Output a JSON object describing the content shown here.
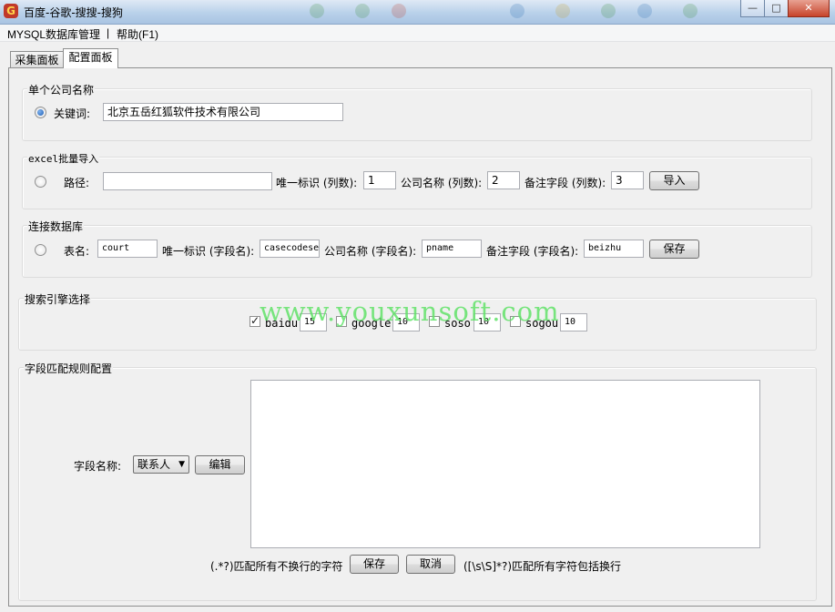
{
  "window": {
    "title": "百度-谷歌-搜搜-搜狗",
    "minimize": "—",
    "maximize": "□",
    "close": "✕"
  },
  "menu": {
    "mysql": "MYSQL数据库管理",
    "separator": "|",
    "help": "帮助(F1)"
  },
  "tabs": {
    "collect": "采集面板",
    "config": "配置面板"
  },
  "single_company": {
    "title": "单个公司名称",
    "keyword_label": "关键词:",
    "keyword_value": "北京五岳红狐软件技术有限公司",
    "selected": true
  },
  "excel_import": {
    "title": "excel批量导入",
    "path_label": "路径:",
    "path_value": "",
    "id_label": "唯一标识 (列数):",
    "id_value": "1",
    "name_label": "公司名称 (列数):",
    "name_value": "2",
    "remark_label": "备注字段 (列数):",
    "remark_value": "3",
    "import_button": "导入"
  },
  "db_connect": {
    "title": "连接数据库",
    "table_label": "表名:",
    "table_value": "court",
    "id_label": "唯一标识 (字段名):",
    "id_value": "casecodese",
    "name_label": "公司名称 (字段名):",
    "name_value": "pname",
    "remark_label": "备注字段 (字段名):",
    "remark_value": "beizhu",
    "save_button": "保存"
  },
  "search_engines": {
    "title": "搜索引擎选择",
    "engines": [
      {
        "name": "baidu",
        "checked": true,
        "count": "15"
      },
      {
        "name": "google",
        "checked": false,
        "count": "10"
      },
      {
        "name": "soso",
        "checked": false,
        "count": "10"
      },
      {
        "name": "sogou",
        "checked": false,
        "count": "10"
      }
    ]
  },
  "field_rules": {
    "title": "字段匹配规则配置",
    "field_label": "字段名称:",
    "field_selected": "联系人",
    "edit_button": "编辑",
    "rule_text": "",
    "hint_left": "(.*?)匹配所有不换行的字符",
    "save_button": "保存",
    "cancel_button": "取消",
    "hint_right": "([\\s\\S]*?)匹配所有字符包括换行"
  },
  "watermark": "www.youxunsoft.com"
}
